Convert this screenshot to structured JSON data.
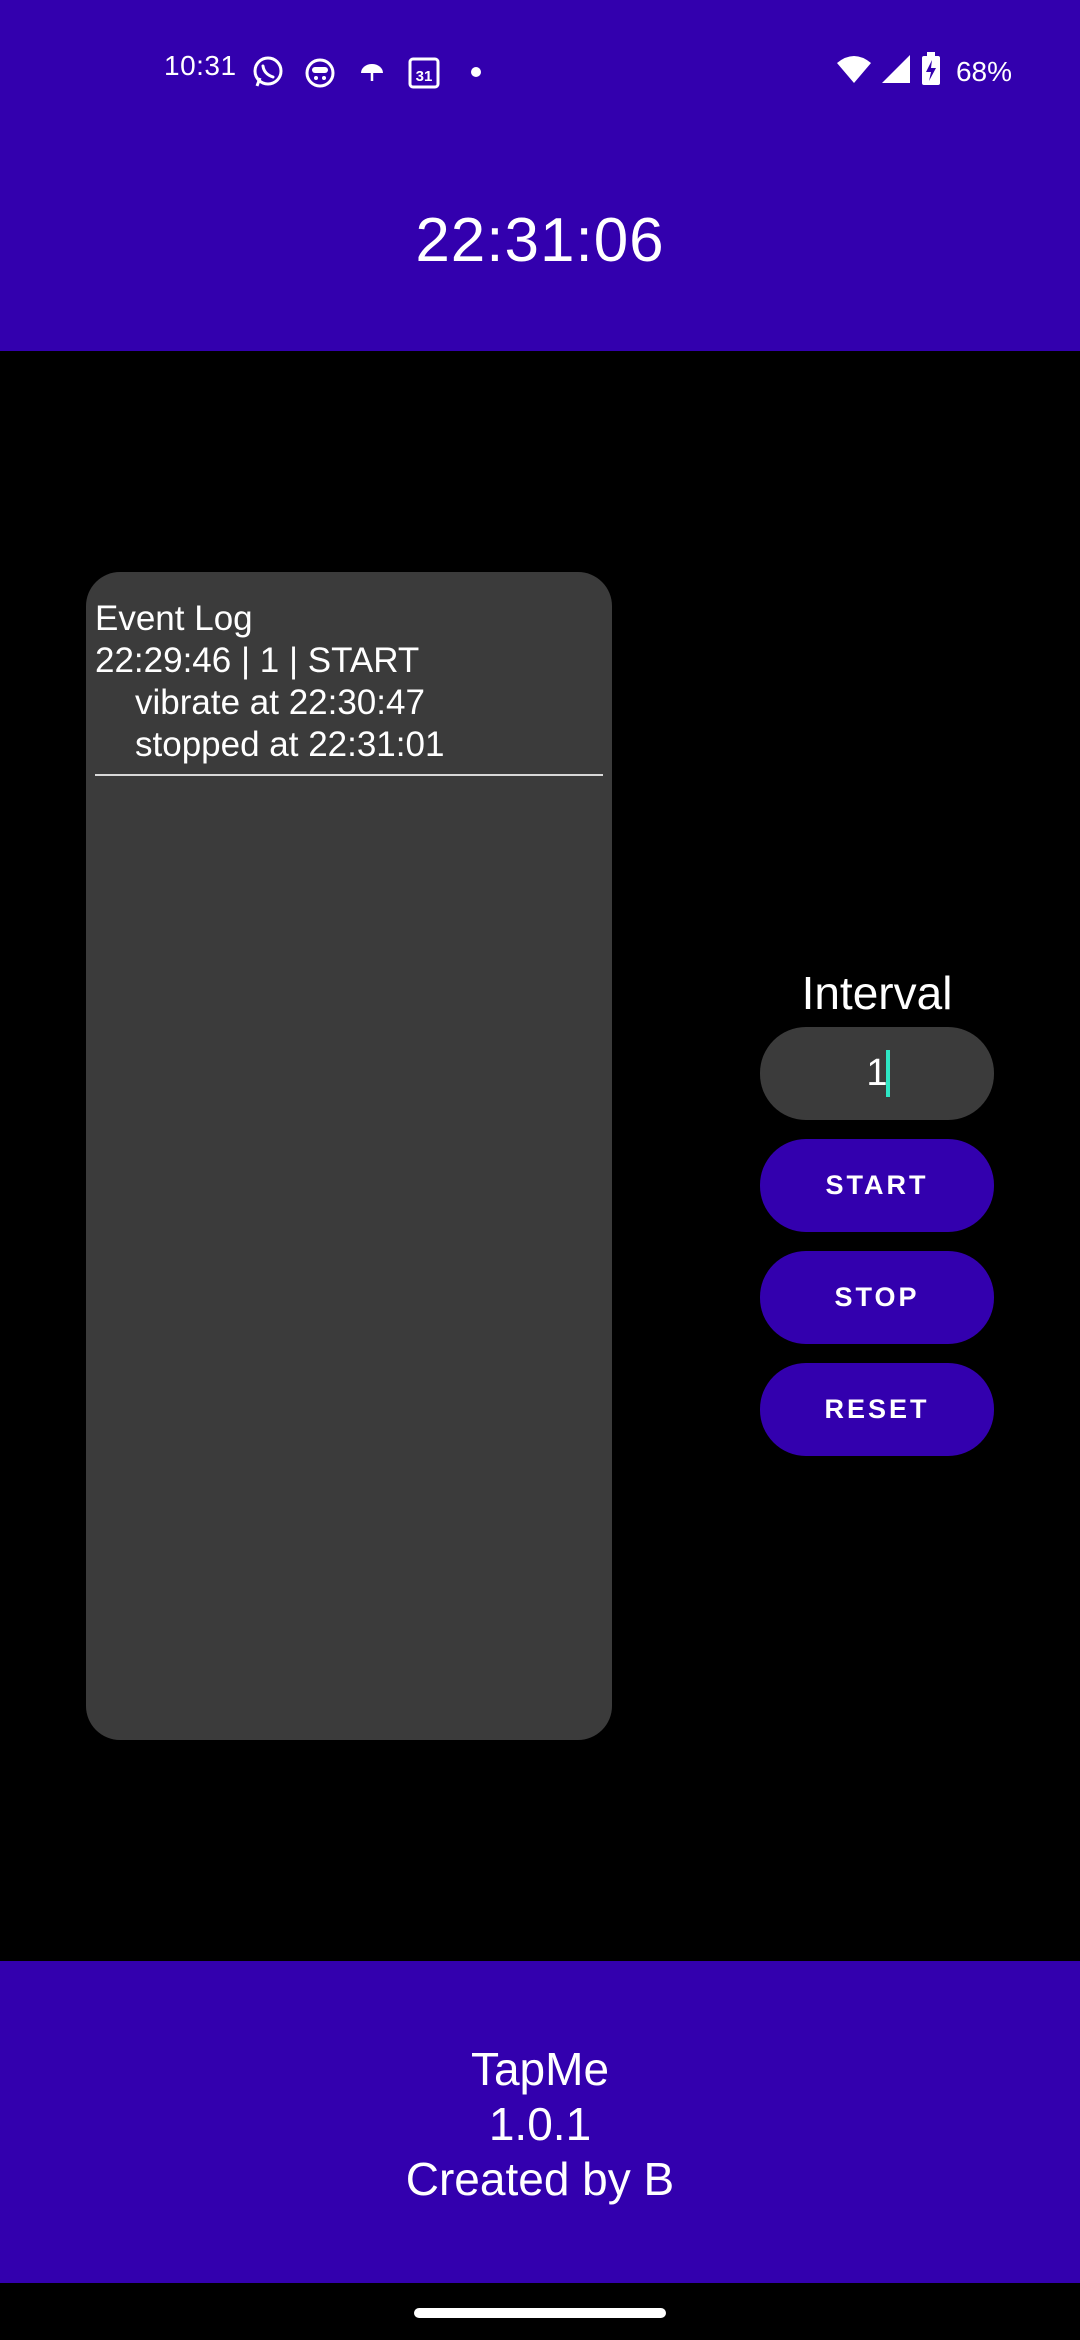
{
  "status_bar": {
    "time": "10:31",
    "battery_percent": "68%",
    "calendar_day": "31",
    "left_icons": [
      "whatsapp-icon",
      "cat-icon",
      "umbrella-icon",
      "calendar-icon",
      "dot-icon"
    ],
    "right_icons": [
      "wifi-icon",
      "signal-icon",
      "battery-charging-icon"
    ]
  },
  "header": {
    "clock": "22:31:06",
    "background_color": "#3300AE"
  },
  "event_log": {
    "title": "Event Log",
    "entries": [
      {
        "head": "22:29:46 | 1 | START",
        "details": [
          "vibrate at 22:30:47",
          "stopped at 22:31:01"
        ]
      }
    ]
  },
  "controls": {
    "interval_label": "Interval",
    "interval_value": "1",
    "start_label": "START",
    "stop_label": "STOP",
    "reset_label": "RESET"
  },
  "footer": {
    "app_name": "TapMe",
    "version": "1.0.1",
    "credit": "Created by B"
  },
  "colors": {
    "accent": "#3300AE",
    "panel": "#3b3b3b",
    "background": "#000000",
    "caret": "#2ee6c4"
  }
}
